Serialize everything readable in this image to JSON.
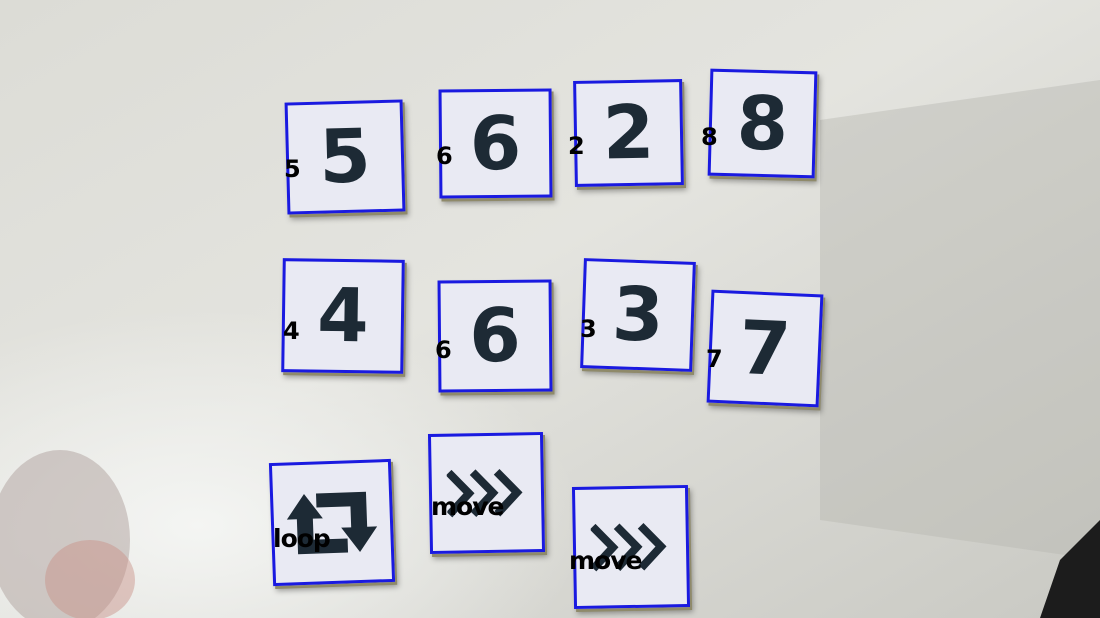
{
  "tiles": [
    {
      "glyph": "5",
      "label": "5"
    },
    {
      "glyph": "6",
      "label": "6"
    },
    {
      "glyph": "2",
      "label": "2"
    },
    {
      "glyph": "8",
      "label": "8"
    },
    {
      "glyph": "4",
      "label": "4"
    },
    {
      "glyph": "6",
      "label": "6"
    },
    {
      "glyph": "3",
      "label": "3"
    },
    {
      "glyph": "7",
      "label": "7"
    },
    {
      "icon": "loop-arrows-icon",
      "label": "loop"
    },
    {
      "icon": "fast-forward-chevrons-icon",
      "label": "move"
    },
    {
      "icon": "fast-forward-chevrons-icon",
      "label": "move"
    }
  ],
  "colors": {
    "detection_box": "#1a1ae0",
    "tile_face": "#e9eaf3",
    "glyph": "#1d2a35",
    "label": "#000000"
  }
}
